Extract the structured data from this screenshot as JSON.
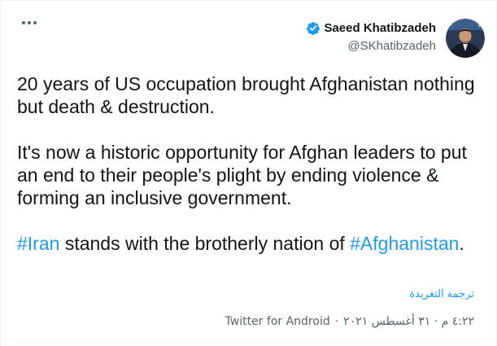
{
  "tweet": {
    "author": {
      "name": "Saeed Khatibzadeh",
      "handle": "@SKhatibzadeh",
      "verified": true
    },
    "body": {
      "p1": "20 years of US occupation brought Afghanistan nothing but death & destruction.",
      "p2": "It's now a historic opportunity for Afghan leaders to put an end to their people's plight by ending violence & forming an inclusive government.",
      "p3_hashtag1": "#Iran",
      "p3_text": " stands with the brotherly nation of ",
      "p3_hashtag2": "#Afghanistan",
      "p3_end": "."
    },
    "translate_label": "ترجمة التغريدة",
    "meta": {
      "time": "٤:٢٢ م",
      "date": "٣١ أغسطس ٢٠٢١",
      "separator": "·",
      "source": "Twitter for Android"
    }
  },
  "icons": {
    "more": "more-horizontal-icon",
    "verified": "verified-badge-icon"
  },
  "colors": {
    "link": "#1d9bf0",
    "text": "#0f1419",
    "secondary": "#536471"
  }
}
